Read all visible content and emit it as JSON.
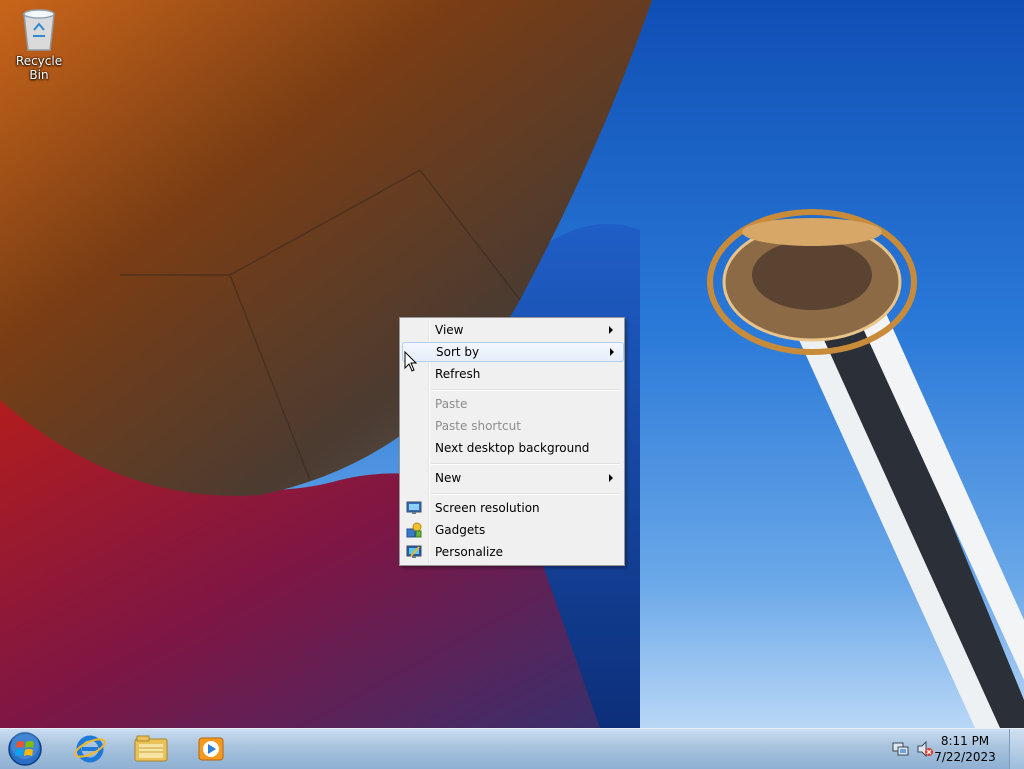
{
  "desktop": {
    "icons": [
      {
        "label": "Recycle Bin",
        "icon": "recycle-bin-icon"
      }
    ]
  },
  "context_menu": {
    "items": [
      {
        "label": "View",
        "submenu": true,
        "disabled": false
      },
      {
        "label": "Sort by",
        "submenu": true,
        "disabled": false,
        "highlighted": true
      },
      {
        "label": "Refresh",
        "submenu": false,
        "disabled": false
      },
      {
        "label": "Paste",
        "submenu": false,
        "disabled": true
      },
      {
        "label": "Paste shortcut",
        "submenu": false,
        "disabled": true
      },
      {
        "label": "Next desktop background",
        "submenu": false,
        "disabled": false
      },
      {
        "label": "New",
        "submenu": true,
        "disabled": false
      },
      {
        "label": "Screen resolution",
        "submenu": false,
        "disabled": false,
        "icon": "screen-resolution-icon"
      },
      {
        "label": "Gadgets",
        "submenu": false,
        "disabled": false,
        "icon": "gadgets-icon"
      },
      {
        "label": "Personalize",
        "submenu": false,
        "disabled": false,
        "icon": "personalize-icon"
      }
    ]
  },
  "taskbar": {
    "start_icon": "windows-start-icon",
    "pinned": [
      {
        "icon": "internet-explorer-icon"
      },
      {
        "icon": "file-explorer-icon"
      },
      {
        "icon": "media-player-icon"
      }
    ],
    "tray": {
      "network_icon": "network-icon",
      "volume_icon": "volume-muted-icon",
      "time": "8:11 PM",
      "date": "7/22/2023"
    }
  },
  "colors": {
    "menu_bg": "#f0f0f0",
    "menu_border": "#979797",
    "highlight_border": "#aecff7",
    "sky": "#2a79d8"
  }
}
